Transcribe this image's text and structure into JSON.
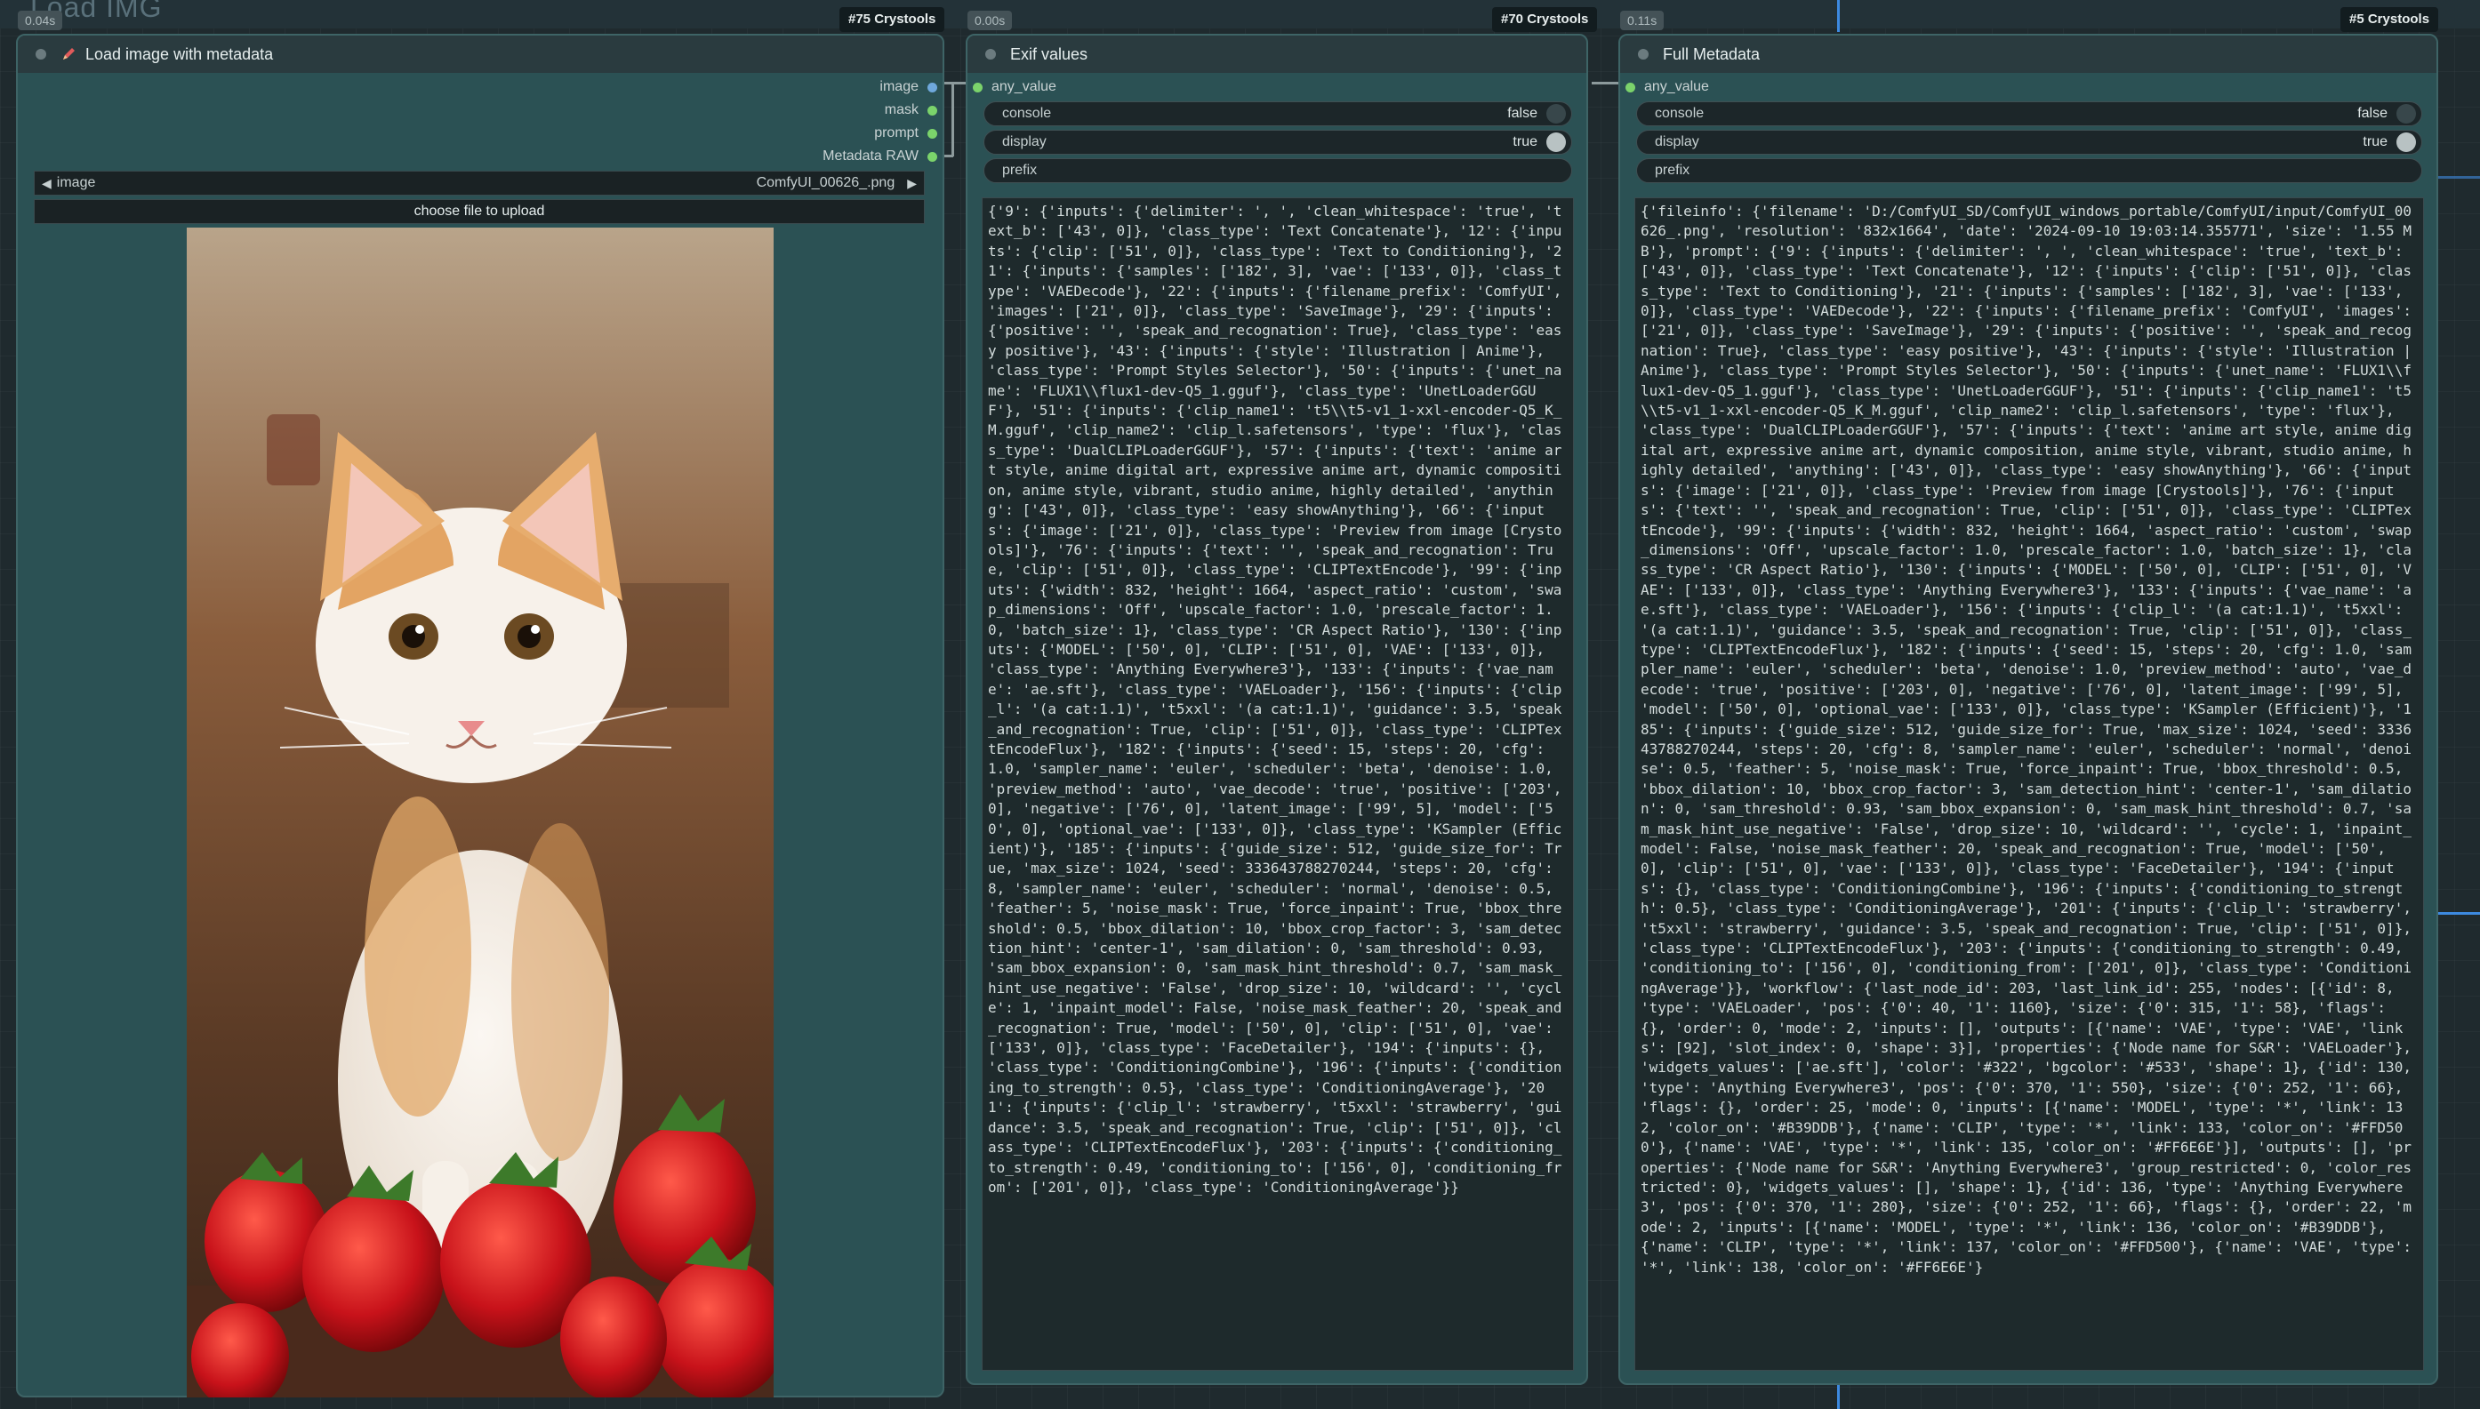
{
  "canvas": {
    "group_title": "Load IMG",
    "link_color": "#3d8ae0"
  },
  "node_load": {
    "time_badge": "0.04s",
    "id_badge": "#75 Crystools",
    "title": "Load image with metadata",
    "icon": "pencil-icon",
    "outputs": [
      {
        "label": "image",
        "color": "#6fa8dc"
      },
      {
        "label": "mask",
        "color": "#7bd36b"
      },
      {
        "label": "prompt",
        "color": "#7bd36b"
      },
      {
        "label": "Metadata RAW",
        "color": "#7bd36b"
      }
    ],
    "image_widget": {
      "label": "image",
      "value": "ComfyUI_00626_.png"
    },
    "upload_button": "choose file to upload"
  },
  "node_exif": {
    "time_badge": "0.00s",
    "id_badge": "#70 Crystools",
    "title": "Exif values",
    "input_label": "any_value",
    "console": {
      "label": "console",
      "value": "false"
    },
    "display": {
      "label": "display",
      "value": "true"
    },
    "prefix": {
      "label": "prefix",
      "value": ""
    },
    "text": "{'9': {'inputs': {'delimiter': ', ', 'clean_whitespace': 'true', 'text_b': ['43', 0]}, 'class_type': 'Text Concatenate'}, '12': {'inputs': {'clip': ['51', 0]}, 'class_type': 'Text to Conditioning'}, '21': {'inputs': {'samples': ['182', 3], 'vae': ['133', 0]}, 'class_type': 'VAEDecode'}, '22': {'inputs': {'filename_prefix': 'ComfyUI', 'images': ['21', 0]}, 'class_type': 'SaveImage'}, '29': {'inputs': {'positive': '', 'speak_and_recognation': True}, 'class_type': 'easy positive'}, '43': {'inputs': {'style': 'Illustration | Anime'}, 'class_type': 'Prompt Styles Selector'}, '50': {'inputs': {'unet_name': 'FLUX1\\\\flux1-dev-Q5_1.gguf'}, 'class_type': 'UnetLoaderGGUF'}, '51': {'inputs': {'clip_name1': 't5\\\\t5-v1_1-xxl-encoder-Q5_K_M.gguf', 'clip_name2': 'clip_l.safetensors', 'type': 'flux'}, 'class_type': 'DualCLIPLoaderGGUF'}, '57': {'inputs': {'text': 'anime art style, anime digital art, expressive anime art, dynamic composition, anime style, vibrant, studio anime, highly detailed', 'anything': ['43', 0]}, 'class_type': 'easy showAnything'}, '66': {'inputs': {'image': ['21', 0]}, 'class_type': 'Preview from image [Crystools]'}, '76': {'inputs': {'text': '', 'speak_and_recognation': True, 'clip': ['51', 0]}, 'class_type': 'CLIPTextEncode'}, '99': {'inputs': {'width': 832, 'height': 1664, 'aspect_ratio': 'custom', 'swap_dimensions': 'Off', 'upscale_factor': 1.0, 'prescale_factor': 1.0, 'batch_size': 1}, 'class_type': 'CR Aspect Ratio'}, '130': {'inputs': {'MODEL': ['50', 0], 'CLIP': ['51', 0], 'VAE': ['133', 0]}, 'class_type': 'Anything Everywhere3'}, '133': {'inputs': {'vae_name': 'ae.sft'}, 'class_type': 'VAELoader'}, '156': {'inputs': {'clip_l': '(a cat:1.1)', 't5xxl': '(a cat:1.1)', 'guidance': 3.5, 'speak_and_recognation': True, 'clip': ['51', 0]}, 'class_type': 'CLIPTextEncodeFlux'}, '182': {'inputs': {'seed': 15, 'steps': 20, 'cfg': 1.0, 'sampler_name': 'euler', 'scheduler': 'beta', 'denoise': 1.0, 'preview_method': 'auto', 'vae_decode': 'true', 'positive': ['203', 0], 'negative': ['76', 0], 'latent_image': ['99', 5], 'model': ['50', 0], 'optional_vae': ['133', 0]}, 'class_type': 'KSampler (Efficient)'}, '185': {'inputs': {'guide_size': 512, 'guide_size_for': True, 'max_size': 1024, 'seed': 333643788270244, 'steps': 20, 'cfg': 8, 'sampler_name': 'euler', 'scheduler': 'normal', 'denoise': 0.5, 'feather': 5, 'noise_mask': True, 'force_inpaint': True, 'bbox_threshold': 0.5, 'bbox_dilation': 10, 'bbox_crop_factor': 3, 'sam_detection_hint': 'center-1', 'sam_dilation': 0, 'sam_threshold': 0.93, 'sam_bbox_expansion': 0, 'sam_mask_hint_threshold': 0.7, 'sam_mask_hint_use_negative': 'False', 'drop_size': 10, 'wildcard': '', 'cycle': 1, 'inpaint_model': False, 'noise_mask_feather': 20, 'speak_and_recognation': True, 'model': ['50', 0], 'clip': ['51', 0], 'vae': ['133', 0]}, 'class_type': 'FaceDetailer'}, '194': {'inputs': {}, 'class_type': 'ConditioningCombine'}, '196': {'inputs': {'conditioning_to_strength': 0.5}, 'class_type': 'ConditioningAverage'}, '201': {'inputs': {'clip_l': 'strawberry', 't5xxl': 'strawberry', 'guidance': 3.5, 'speak_and_recognation': True, 'clip': ['51', 0]}, 'class_type': 'CLIPTextEncodeFlux'}, '203': {'inputs': {'conditioning_to_strength': 0.49, 'conditioning_to': ['156', 0], 'conditioning_from': ['201', 0]}, 'class_type': 'ConditioningAverage'}}"
  },
  "node_full": {
    "time_badge": "0.11s",
    "id_badge": "#5 Crystools",
    "title": "Full Metadata",
    "input_label": "any_value",
    "console": {
      "label": "console",
      "value": "false"
    },
    "display": {
      "label": "display",
      "value": "true"
    },
    "prefix": {
      "label": "prefix",
      "value": ""
    },
    "text": "{'fileinfo': {'filename': 'D:/ComfyUI_SD/ComfyUI_windows_portable/ComfyUI/input/ComfyUI_00626_.png', 'resolution': '832x1664', 'date': '2024-09-10 19:03:14.355771', 'size': '1.55 MB'}, 'prompt': {'9': {'inputs': {'delimiter': ', ', 'clean_whitespace': 'true', 'text_b': ['43', 0]}, 'class_type': 'Text Concatenate'}, '12': {'inputs': {'clip': ['51', 0]}, 'class_type': 'Text to Conditioning'}, '21': {'inputs': {'samples': ['182', 3], 'vae': ['133', 0]}, 'class_type': 'VAEDecode'}, '22': {'inputs': {'filename_prefix': 'ComfyUI', 'images': ['21', 0]}, 'class_type': 'SaveImage'}, '29': {'inputs': {'positive': '', 'speak_and_recognation': True}, 'class_type': 'easy positive'}, '43': {'inputs': {'style': 'Illustration | Anime'}, 'class_type': 'Prompt Styles Selector'}, '50': {'inputs': {'unet_name': 'FLUX1\\\\flux1-dev-Q5_1.gguf'}, 'class_type': 'UnetLoaderGGUF'}, '51': {'inputs': {'clip_name1': 't5\\\\t5-v1_1-xxl-encoder-Q5_K_M.gguf', 'clip_name2': 'clip_l.safetensors', 'type': 'flux'}, 'class_type': 'DualCLIPLoaderGGUF'}, '57': {'inputs': {'text': 'anime art style, anime digital art, expressive anime art, dynamic composition, anime style, vibrant, studio anime, highly detailed', 'anything': ['43', 0]}, 'class_type': 'easy showAnything'}, '66': {'inputs': {'image': ['21', 0]}, 'class_type': 'Preview from image [Crystools]'}, '76': {'inputs': {'text': '', 'speak_and_recognation': True, 'clip': ['51', 0]}, 'class_type': 'CLIPTextEncode'}, '99': {'inputs': {'width': 832, 'height': 1664, 'aspect_ratio': 'custom', 'swap_dimensions': 'Off', 'upscale_factor': 1.0, 'prescale_factor': 1.0, 'batch_size': 1}, 'class_type': 'CR Aspect Ratio'}, '130': {'inputs': {'MODEL': ['50', 0], 'CLIP': ['51', 0], 'VAE': ['133', 0]}, 'class_type': 'Anything Everywhere3'}, '133': {'inputs': {'vae_name': 'ae.sft'}, 'class_type': 'VAELoader'}, '156': {'inputs': {'clip_l': '(a cat:1.1)', 't5xxl': '(a cat:1.1)', 'guidance': 3.5, 'speak_and_recognation': True, 'clip': ['51', 0]}, 'class_type': 'CLIPTextEncodeFlux'}, '182': {'inputs': {'seed': 15, 'steps': 20, 'cfg': 1.0, 'sampler_name': 'euler', 'scheduler': 'beta', 'denoise': 1.0, 'preview_method': 'auto', 'vae_decode': 'true', 'positive': ['203', 0], 'negative': ['76', 0], 'latent_image': ['99', 5], 'model': ['50', 0], 'optional_vae': ['133', 0]}, 'class_type': 'KSampler (Efficient)'}, '185': {'inputs': {'guide_size': 512, 'guide_size_for': True, 'max_size': 1024, 'seed': 333643788270244, 'steps': 20, 'cfg': 8, 'sampler_name': 'euler', 'scheduler': 'normal', 'denoise': 0.5, 'feather': 5, 'noise_mask': True, 'force_inpaint': True, 'bbox_threshold': 0.5, 'bbox_dilation': 10, 'bbox_crop_factor': 3, 'sam_detection_hint': 'center-1', 'sam_dilation': 0, 'sam_threshold': 0.93, 'sam_bbox_expansion': 0, 'sam_mask_hint_threshold': 0.7, 'sam_mask_hint_use_negative': 'False', 'drop_size': 10, 'wildcard': '', 'cycle': 1, 'inpaint_model': False, 'noise_mask_feather': 20, 'speak_and_recognation': True, 'model': ['50', 0], 'clip': ['51', 0], 'vae': ['133', 0]}, 'class_type': 'FaceDetailer'}, '194': {'inputs': {}, 'class_type': 'ConditioningCombine'}, '196': {'inputs': {'conditioning_to_strength': 0.5}, 'class_type': 'ConditioningAverage'}, '201': {'inputs': {'clip_l': 'strawberry', 't5xxl': 'strawberry', 'guidance': 3.5, 'speak_and_recognation': True, 'clip': ['51', 0]}, 'class_type': 'CLIPTextEncodeFlux'}, '203': {'inputs': {'conditioning_to_strength': 0.49, 'conditioning_to': ['156', 0], 'conditioning_from': ['201', 0]}, 'class_type': 'ConditioningAverage'}}, 'workflow': {'last_node_id': 203, 'last_link_id': 255, 'nodes': [{'id': 8, 'type': 'VAELoader', 'pos': {'0': 40, '1': 1160}, 'size': {'0': 315, '1': 58}, 'flags': {}, 'order': 0, 'mode': 2, 'inputs': [], 'outputs': [{'name': 'VAE', 'type': 'VAE', 'links': [92], 'slot_index': 0, 'shape': 3}], 'properties': {'Node name for S&R': 'VAELoader'}, 'widgets_values': ['ae.sft'], 'color': '#322', 'bgcolor': '#533', 'shape': 1}, {'id': 130, 'type': 'Anything Everywhere3', 'pos': {'0': 370, '1': 550}, 'size': {'0': 252, '1': 66}, 'flags': {}, 'order': 25, 'mode': 0, 'inputs': [{'name': 'MODEL', 'type': '*', 'link': 132, 'color_on': '#B39DDB'}, {'name': 'CLIP', 'type': '*', 'link': 133, 'color_on': '#FFD500'}, {'name': 'VAE', 'type': '*', 'link': 135, 'color_on': '#FF6E6E'}], 'outputs': [], 'properties': {'Node name for S&R': 'Anything Everywhere3', 'group_restricted': 0, 'color_restricted': 0}, 'widgets_values': [], 'shape': 1}, {'id': 136, 'type': 'Anything Everywhere3', 'pos': {'0': 370, '1': 280}, 'size': {'0': 252, '1': 66}, 'flags': {}, 'order': 22, 'mode': 2, 'inputs': [{'name': 'MODEL', 'type': '*', 'link': 136, 'color_on': '#B39DDB'}, {'name': 'CLIP', 'type': '*', 'link': 137, 'color_on': '#FFD500'}, {'name': 'VAE', 'type': '*', 'link': 138, 'color_on': '#FF6E6E'}"
  }
}
